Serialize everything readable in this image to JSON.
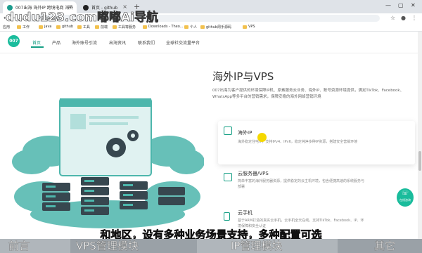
{
  "watermark": "dudu123.com嘟嘟Ai导航",
  "browser": {
    "tabs": [
      {
        "label": "007出海 海外IP 跨境电商 海外IP 账号环..."
      },
      {
        "label": "首页 - github"
      }
    ],
    "url": "007ip.com",
    "bookmarks": [
      "应用",
      "工作",
      "java",
      "github",
      "工具",
      "前端",
      "工具等服务",
      "Downloads - Theo...",
      "个人",
      "github周手源码",
      "VPS"
    ]
  },
  "site": {
    "logo": "007",
    "nav": [
      "首页",
      "产品",
      "海外账号引流",
      "出海资讯",
      "联系我们",
      "全球社交流量平台"
    ]
  },
  "hero": {
    "title": "海外IP与VPS",
    "description": "007出海为客户提供的环境保障IP机、原素服务云业务、海外IP、账号资源环境提供，满足TikTok、Facebook、WhatsApp等多平台的营销需求，保障安稳的海外网络营销环境"
  },
  "cards": [
    {
      "title": "海外IP",
      "desc": "海外稳定住宅IP，支持IPv4、IPv6，稳定纯净多种IP资源，搭建安全营销环境"
    },
    {
      "title": "云服务器/VPS",
      "desc": "简单丰富的海外服务器资源，提供稳定的云主机环境，包含便捷高速的系统服务与部署"
    },
    {
      "title": "云手机",
      "desc": "基于ARM打造的真实云手机，云手机全天在线，支持TikTok、Facebook、IP、环境保障和安全认证"
    }
  ],
  "service_label": "在线咨询",
  "subtitle": "和地区，设有多种业务场景支持，多种配置可选",
  "bottom_strip": [
    "前言",
    "VPS管理模块",
    "IP管理模块",
    "其它"
  ],
  "colors": {
    "accent": "#16a085",
    "cloud": "#4db6ac",
    "cursor": "#f5d800"
  }
}
